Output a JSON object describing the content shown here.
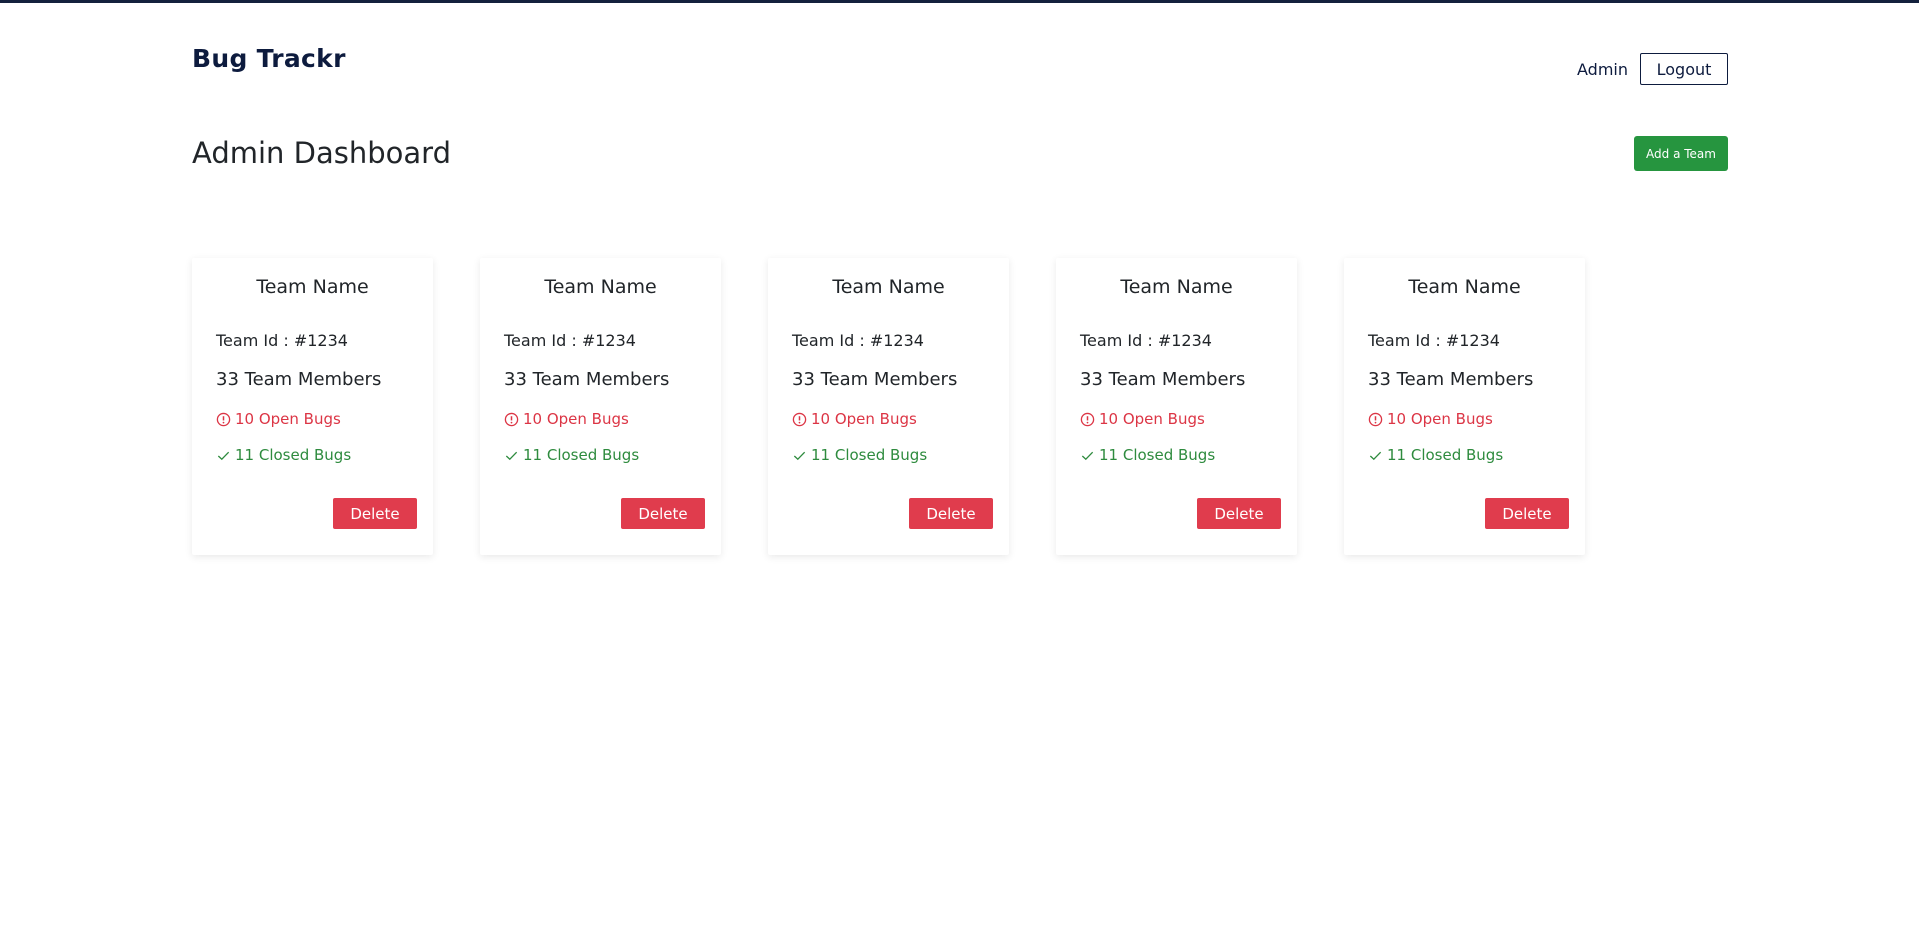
{
  "header": {
    "brand": "Bug Trackr",
    "user_name": "Admin",
    "logout_label": "Logout"
  },
  "main": {
    "title": "Admin Dashboard",
    "add_team_label": "Add a Team"
  },
  "colors": {
    "brand": "#0d1b3e",
    "success": "#26953f",
    "danger": "#e03c4d",
    "open_bugs": "#dc3545",
    "closed_bugs": "#2e8b3e"
  },
  "cards": [
    {
      "title": "Team Name",
      "team_id": "Team Id : #1234",
      "members": "33 Team Members",
      "open_bugs": "10 Open Bugs",
      "closed_bugs": "11 Closed Bugs",
      "delete_label": "Delete",
      "open_icon": "alert-circle-icon",
      "closed_icon": "check-icon"
    },
    {
      "title": "Team Name",
      "team_id": "Team Id : #1234",
      "members": "33 Team Members",
      "open_bugs": "10 Open Bugs",
      "closed_bugs": "11 Closed Bugs",
      "delete_label": "Delete",
      "open_icon": "alert-circle-icon",
      "closed_icon": "check-icon"
    },
    {
      "title": "Team Name",
      "team_id": "Team Id : #1234",
      "members": "33 Team Members",
      "open_bugs": "10 Open Bugs",
      "closed_bugs": "11 Closed Bugs",
      "delete_label": "Delete",
      "open_icon": "alert-circle-icon",
      "closed_icon": "check-icon"
    },
    {
      "title": "Team Name",
      "team_id": "Team Id : #1234",
      "members": "33 Team Members",
      "open_bugs": "10 Open Bugs",
      "closed_bugs": "11 Closed Bugs",
      "delete_label": "Delete",
      "open_icon": "alert-circle-icon",
      "closed_icon": "check-icon"
    },
    {
      "title": "Team Name",
      "team_id": "Team Id : #1234",
      "members": "33 Team Members",
      "open_bugs": "10 Open Bugs",
      "closed_bugs": "11 Closed Bugs",
      "delete_label": "Delete",
      "open_icon": "alert-circle-icon",
      "closed_icon": "check-icon"
    }
  ]
}
